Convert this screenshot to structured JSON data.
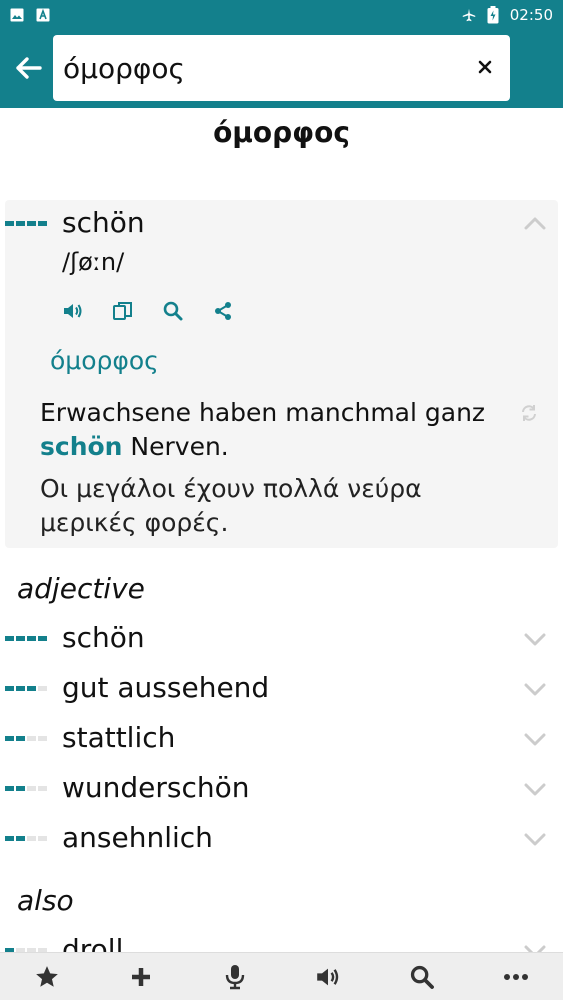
{
  "status_bar": {
    "time": "02:50",
    "icons": [
      "image-icon",
      "text-a-icon",
      "airplane-icon",
      "battery-icon"
    ]
  },
  "search": {
    "value": "όμορφος",
    "placeholder": ""
  },
  "headword": "όμορφος",
  "main_entry": {
    "term": "schön",
    "frequency": 4,
    "phonetic": "/ʃøːn/",
    "translation": "όμορφος",
    "example_de_before": "Erwachsene haben manchmal ganz ",
    "example_de_highlight": "schön",
    "example_de_after": " Nerven.",
    "example_el": "Οι μεγάλοι έχουν πολλά νεύρα μερικές φορές."
  },
  "sections": [
    {
      "label": "adjective",
      "entries": [
        {
          "term": "schön",
          "frequency": 4
        },
        {
          "term": "gut aussehend",
          "frequency": 3
        },
        {
          "term": "stattlich",
          "frequency": 2
        },
        {
          "term": "wunderschön",
          "frequency": 2
        },
        {
          "term": "ansehnlich",
          "frequency": 2
        }
      ]
    },
    {
      "label": "also",
      "entries": [
        {
          "term": "droll",
          "frequency": 1
        }
      ]
    }
  ],
  "colors": {
    "accent": "#13808c",
    "card_bg": "#f5f5f5",
    "nav_bg": "#eeeeee"
  },
  "bottom_nav": [
    "star-icon",
    "plus-icon",
    "microphone-icon",
    "speaker-icon",
    "search-icon",
    "more-icon"
  ]
}
